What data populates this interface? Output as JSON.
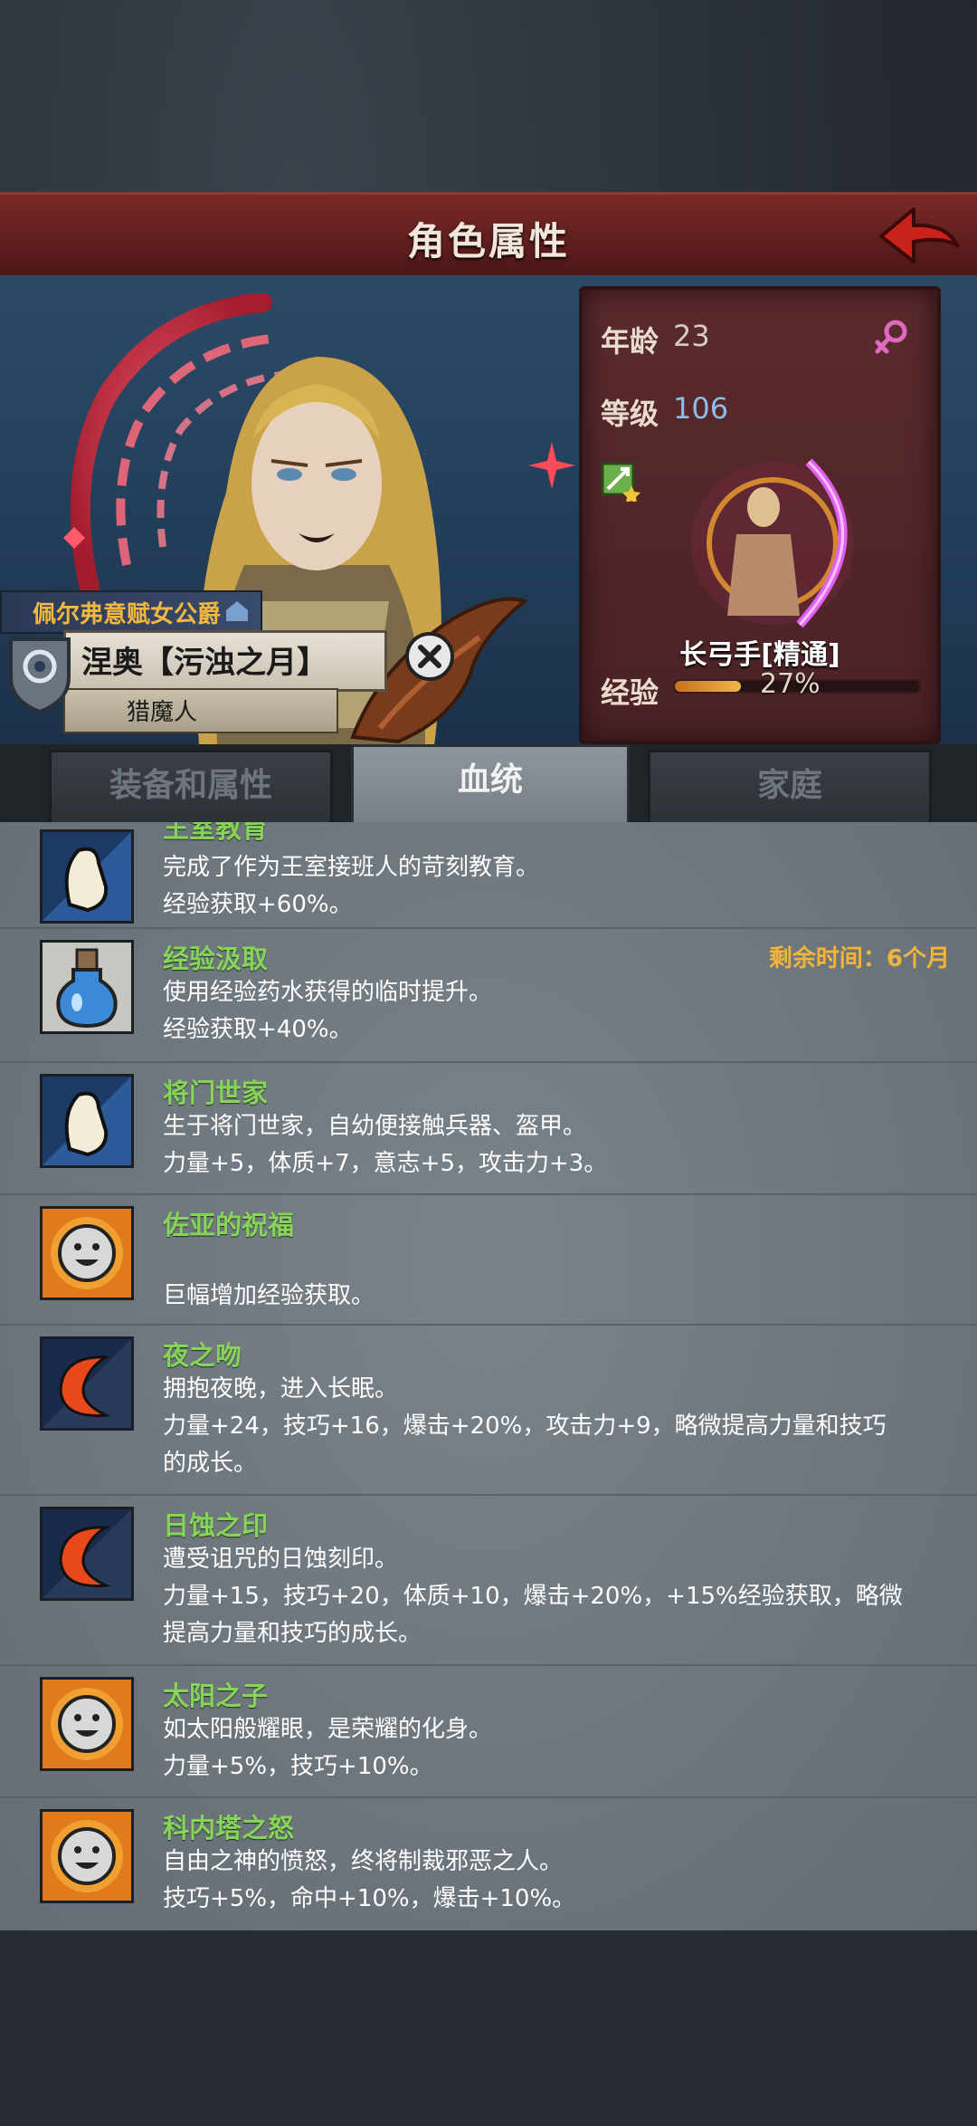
{
  "header": {
    "title": "角色属性"
  },
  "character": {
    "age_label": "年龄",
    "age": "23",
    "level_label": "等级",
    "level": "106",
    "class_name": "长弓手[精通]",
    "exp_label": "经验",
    "exp_percent": "27%",
    "exp_fraction": 0.27,
    "title": "佩尔弗意赋女公爵",
    "name": "涅奥【污浊之月】",
    "profession": "猎魔人"
  },
  "tabs": [
    {
      "label": "装备和属性",
      "active": false
    },
    {
      "label": "血统",
      "active": true
    },
    {
      "label": "家庭",
      "active": false
    }
  ],
  "traits": [
    {
      "name": "王室教育",
      "icon": "arm-icon",
      "lines": [
        "完成了作为王室接班人的苛刻教育。",
        "经验获取+60%。"
      ]
    },
    {
      "name": "经验汲取",
      "icon": "potion-icon",
      "timer": "剩余时间：6个月",
      "lines": [
        "使用经验药水获得的临时提升。",
        "经验获取+40%。"
      ]
    },
    {
      "name": "将门世家",
      "icon": "arm-icon",
      "lines": [
        "生于将门世家，自幼便接触兵器、盔甲。",
        "力量+5，体质+7，意志+5，攻击力+3。"
      ]
    },
    {
      "name": "佐亚的祝福",
      "icon": "sun-face-icon",
      "lines": [
        "",
        "巨幅增加经验获取。"
      ]
    },
    {
      "name": "夜之吻",
      "icon": "crescent-moon-icon",
      "lines": [
        "拥抱夜晚，进入长眠。",
        "力量+24，技巧+16，爆击+20%，攻击力+9，略微提高力量和技巧",
        "的成长。"
      ]
    },
    {
      "name": "日蚀之印",
      "icon": "crescent-moon-icon",
      "lines": [
        "遭受诅咒的日蚀刻印。",
        "力量+15，技巧+20，体质+10，爆击+20%，+15%经验获取，略微",
        "提高力量和技巧的成长。"
      ]
    },
    {
      "name": "太阳之子",
      "icon": "sun-face-icon",
      "lines": [
        "如太阳般耀眼，是荣耀的化身。",
        "力量+5%，技巧+10%。"
      ]
    },
    {
      "name": "科内塔之怒",
      "icon": "sun-face-icon",
      "lines": [
        "自由之神的愤怒，终将制裁邪恶之人。",
        "技巧+5%，命中+10%，爆击+10%。"
      ]
    }
  ],
  "colors": {
    "trait_name": "#86d45a",
    "timer": "#f2b43a",
    "level": "#8fbbe8"
  }
}
